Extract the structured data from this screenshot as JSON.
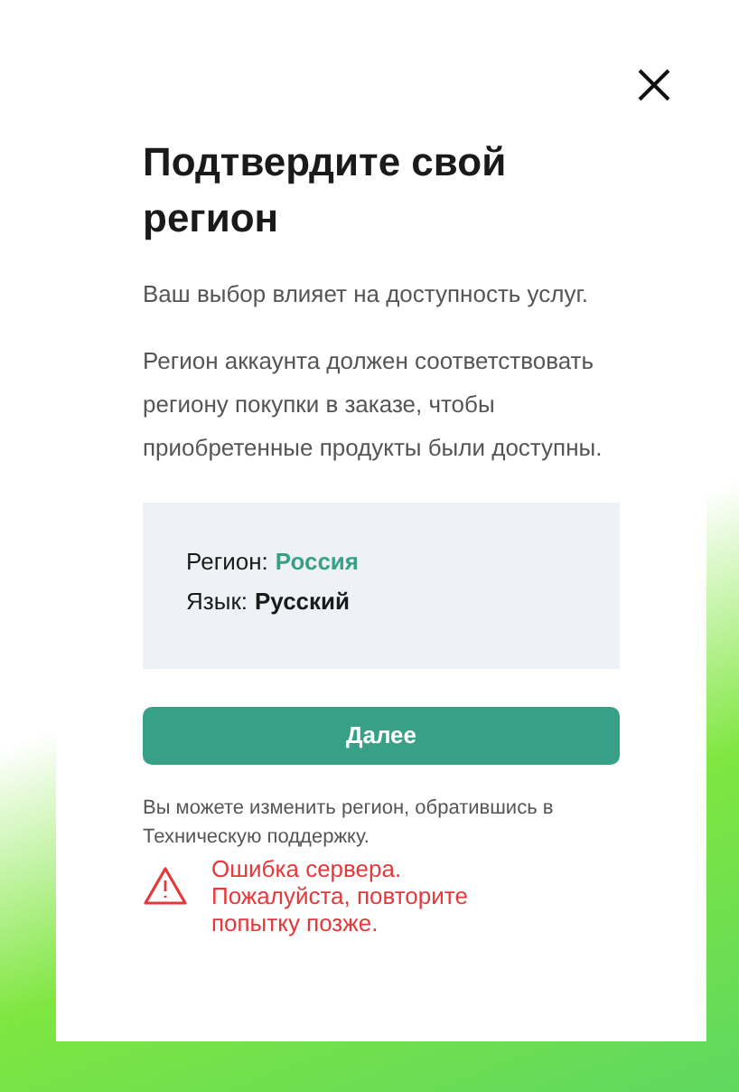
{
  "dialog": {
    "title": "Подтвердите свой регион",
    "subtitle": "Ваш выбор влияет на доступность услуг.",
    "description": "Регион аккаунта должен соответствовать региону покупки в заказе, чтобы приобретенные продукты были доступны.",
    "info": [
      {
        "label": "Регион:",
        "value": "Россия",
        "color": "#37a087"
      },
      {
        "label": "Язык:",
        "value": "Русский",
        "color": "#1a1a1a"
      }
    ],
    "button": "Далее",
    "note": "Вы можете изменить регион, обратившись в Техническую поддержку.",
    "error": "Ошибка сервера. Пожалуйста, повторите попытку позже."
  }
}
